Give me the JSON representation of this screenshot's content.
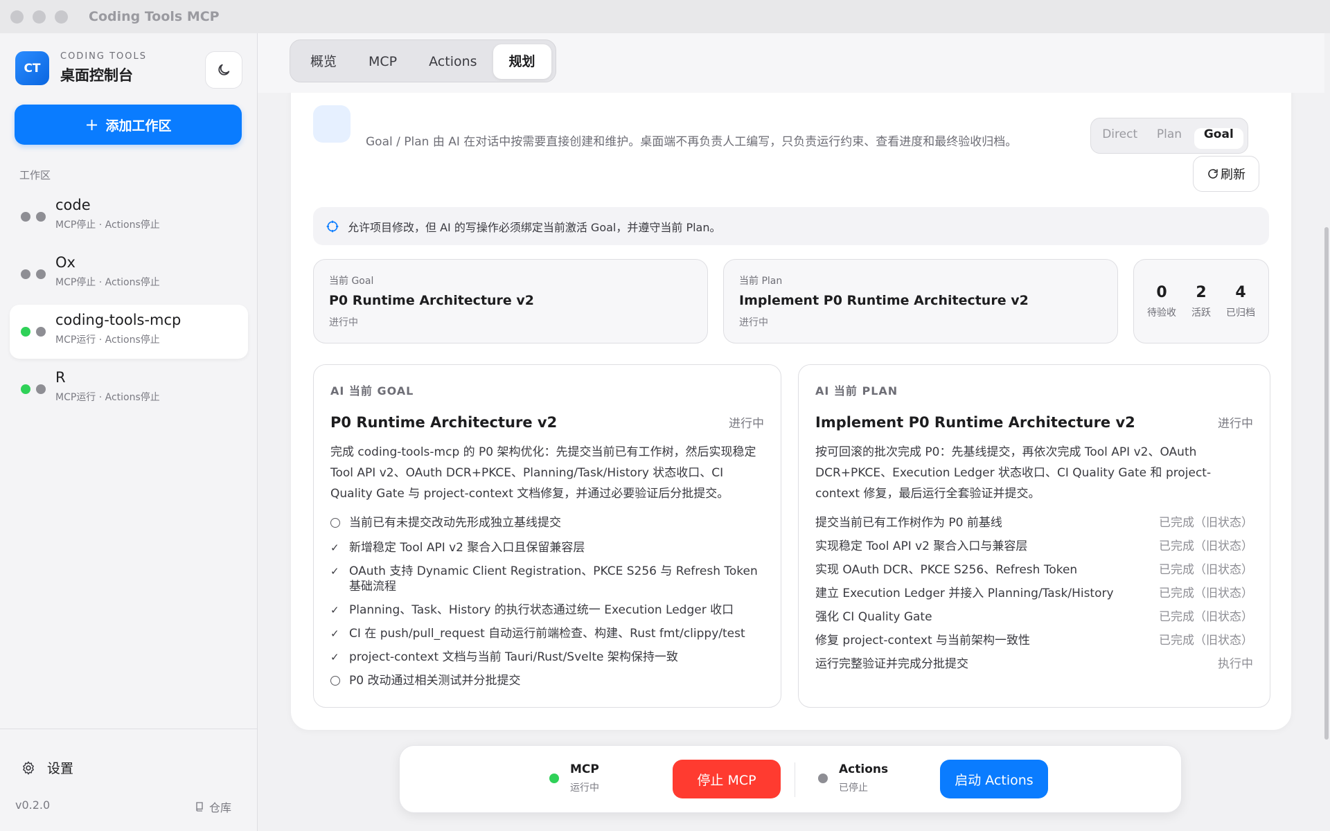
{
  "window": {
    "title": "Coding Tools MCP"
  },
  "sidebar": {
    "brand": {
      "logo": "CT",
      "subtitle": "CODING TOOLS",
      "title": "桌面控制台"
    },
    "theme_icon": "moon-icon",
    "add_workspace": {
      "icon": "plus-icon",
      "label": "添加工作区"
    },
    "section_label": "工作区",
    "workspaces": [
      {
        "name": "code",
        "status": "MCP停止 · Actions停止",
        "mcp_running": false,
        "actions_running": false,
        "active": false
      },
      {
        "name": "Ox",
        "status": "MCP停止 · Actions停止",
        "mcp_running": false,
        "actions_running": false,
        "active": false
      },
      {
        "name": "coding-tools-mcp",
        "status": "MCP运行 · Actions停止",
        "mcp_running": true,
        "actions_running": false,
        "active": true
      },
      {
        "name": "R",
        "status": "MCP运行 · Actions停止",
        "mcp_running": true,
        "actions_running": false,
        "active": false
      }
    ],
    "settings_label": "设置",
    "version": "v0.2.0",
    "repo_label": "仓库"
  },
  "tabs": [
    {
      "label": "概览",
      "active": false
    },
    {
      "label": "MCP",
      "active": false
    },
    {
      "label": "Actions",
      "active": false
    },
    {
      "label": "规划",
      "active": true
    }
  ],
  "planning": {
    "description": "Goal / Plan 由 AI 在对话中按需要直接创建和维护。桌面端不再负责人工编写，只负责运行约束、查看进度和最终验收归档。",
    "mode_segments": [
      {
        "label": "Direct",
        "active": false
      },
      {
        "label": "Plan",
        "active": false
      },
      {
        "label": "Goal",
        "active": true
      }
    ],
    "refresh_label": "刷新",
    "notice": "允许项目修改，但 AI 的写操作必须绑定当前激活 Goal，并遵守当前 Plan。",
    "current_goal": {
      "label": "当前 Goal",
      "title": "P0 Runtime Architecture v2",
      "status": "进行中"
    },
    "current_plan": {
      "label": "当前 Plan",
      "title": "Implement P0 Runtime Architecture v2",
      "status": "进行中"
    },
    "stats": [
      {
        "value": "0",
        "label": "待验收"
      },
      {
        "value": "2",
        "label": "活跃"
      },
      {
        "value": "4",
        "label": "已归档"
      }
    ],
    "ai_goal": {
      "label": "AI 当前 GOAL",
      "title": "P0 Runtime Architecture v2",
      "status": "进行中",
      "body": "完成 coding-tools-mcp 的 P0 架构优化：先提交当前已有工作树，然后实现稳定 Tool API v2、OAuth DCR+PKCE、Planning/Task/History 状态收口、CI Quality Gate 与 project-context 文档修复，并通过必要验证后分批提交。",
      "checklist": [
        {
          "done": false,
          "text": "当前已有未提交改动先形成独立基线提交"
        },
        {
          "done": true,
          "text": "新增稳定 Tool API v2 聚合入口且保留兼容层"
        },
        {
          "done": true,
          "text": "OAuth 支持 Dynamic Client Registration、PKCE S256 与 Refresh Token 基础流程"
        },
        {
          "done": true,
          "text": "Planning、Task、History 的执行状态通过统一 Execution Ledger 收口"
        },
        {
          "done": true,
          "text": "CI 在 push/pull_request 自动运行前端检查、构建、Rust fmt/clippy/test"
        },
        {
          "done": true,
          "text": "project-context 文档与当前 Tauri/Rust/Svelte 架构保持一致"
        },
        {
          "done": false,
          "text": "P0 改动通过相关测试并分批提交"
        }
      ]
    },
    "ai_plan": {
      "label": "AI 当前 PLAN",
      "title": "Implement P0 Runtime Architecture v2",
      "status": "进行中",
      "body": "按可回滚的批次完成 P0：先基线提交，再依次完成 Tool API v2、OAuth DCR+PKCE、Execution Ledger 状态收口、CI Quality Gate 和 project-context 修复，最后运行全套验证并提交。",
      "steps": [
        {
          "text": "提交当前已有工作树作为 P0 前基线",
          "status": "已完成（旧状态）"
        },
        {
          "text": "实现稳定 Tool API v2 聚合入口与兼容层",
          "status": "已完成（旧状态）"
        },
        {
          "text": "实现 OAuth DCR、PKCE S256、Refresh Token",
          "status": "已完成（旧状态）"
        },
        {
          "text": "建立 Execution Ledger 并接入 Planning/Task/History",
          "status": "已完成（旧状态）"
        },
        {
          "text": "强化 CI Quality Gate",
          "status": "已完成（旧状态）"
        },
        {
          "text": "修复 project-context 与当前架构一致性",
          "status": "已完成（旧状态）"
        },
        {
          "text": "运行完整验证并完成分批提交",
          "status": "执行中"
        }
      ]
    }
  },
  "action_bar": {
    "mcp": {
      "name": "MCP",
      "status": "运行中",
      "color": "#2fd158"
    },
    "stop_mcp_label": "停止 MCP",
    "actions": {
      "name": "Actions",
      "status": "已停止",
      "color": "#8e8e94"
    },
    "start_actions_label": "启动 Actions"
  },
  "colors": {
    "accent": "#0a7cff",
    "danger": "#ff3b30",
    "running": "#2fd158",
    "stopped": "#8e8e94"
  }
}
